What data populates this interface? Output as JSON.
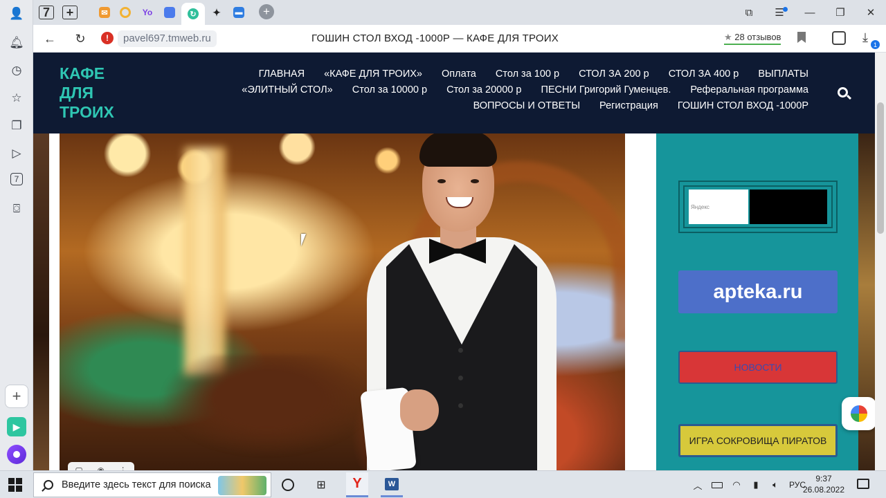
{
  "browser": {
    "domain": "pavel697.tmweb.ru",
    "page_title": "ГОШИН СТОЛ ВХОД -1000Р — КАФЕ ДЛЯ ТРОИХ",
    "reviews_star": "★",
    "reviews_label": "28 отзывов",
    "download_badge": "1",
    "tabs": [
      {
        "name": "home-tab",
        "badge": "7"
      },
      {
        "name": "new-folder-tab"
      },
      {
        "name": "mail-tab",
        "color": "#f09a32"
      },
      {
        "name": "q-tab",
        "color": "#f2b233"
      },
      {
        "name": "yo-tab",
        "color": "#7b3fe4"
      },
      {
        "name": "cube-tab",
        "color": "#4b7bec"
      },
      {
        "name": "active-site-tab",
        "color": "#2fbf9b"
      },
      {
        "name": "sparkle-tab",
        "color": "#222222"
      },
      {
        "name": "chat-tab",
        "color": "#2f7de1"
      }
    ],
    "sidebar_badge": "7"
  },
  "site": {
    "logo": "КАФЕ\nДЛЯ\nТРОИХ",
    "nav": [
      "ГЛАВНАЯ",
      "«КАФЕ ДЛЯ ТРОИХ»",
      "Оплата",
      "Стол за 100 р",
      "СТОЛ ЗА 200 р",
      "СТОЛ ЗА 400 р",
      "ВЫПЛАТЫ",
      "«ЭЛИТНЫЙ СТОЛ»",
      "Стол за 10000 р",
      "Стол за 20000 р",
      "ПЕСНИ Григорий Гуменцев.",
      "Реферальная программа",
      "ВОПРОСЫ И ОТВЕТЫ",
      "Регистрация",
      "ГОШИН СТОЛ ВХОД -1000Р"
    ],
    "sidebar": {
      "yandex_label": "Яндекс",
      "apteka_label": "apteka.ru",
      "news_label": "НОВОСТИ",
      "pirates_label": "ИГРА СОКРОВИЩА ПИРАТОВ"
    }
  },
  "taskbar": {
    "search_placeholder": "Введите здесь текст для поиска",
    "yandex_glyph": "Y",
    "word_glyph": "W",
    "lang": "РУС",
    "time": "9:37",
    "date": "26.08.2022"
  }
}
